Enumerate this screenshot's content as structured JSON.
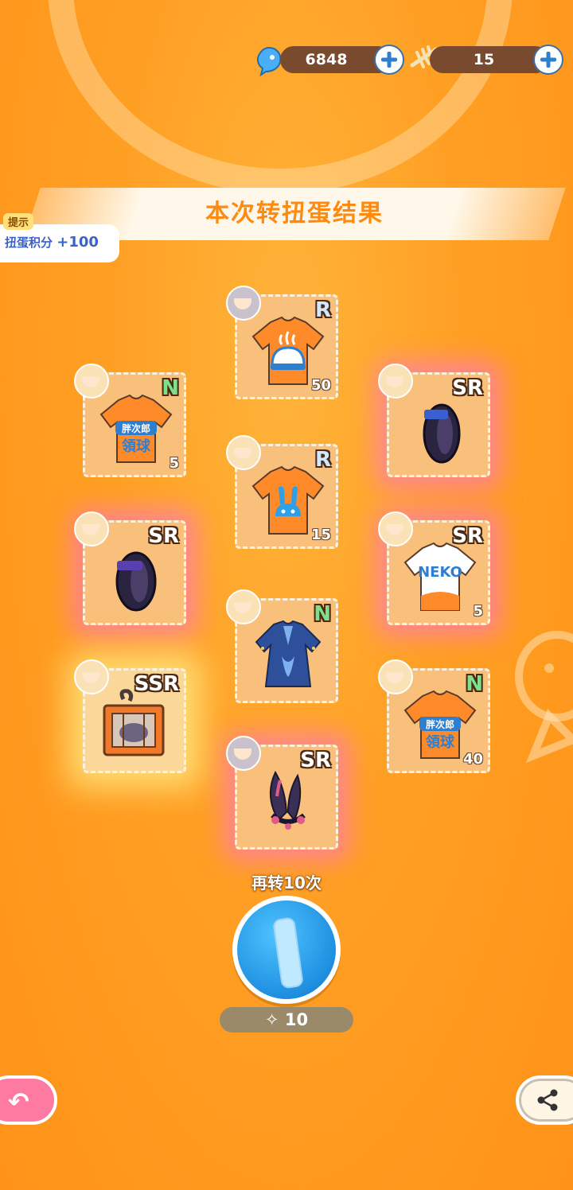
{
  "currency": {
    "gems": {
      "icon": "blue-fish-gem-icon",
      "value": "6848"
    },
    "tickets": {
      "icon": "fish-bone-ticket-icon",
      "value": "15"
    }
  },
  "banner": {
    "title": "本次转扭蛋结果"
  },
  "tip": {
    "tag": "提示",
    "label": "扭蛋积分",
    "points": "+100"
  },
  "items": [
    {
      "rarity": "N",
      "count": "5",
      "kind": "orange-shirt",
      "avatar": "cat-girl"
    },
    {
      "rarity": "R",
      "count": "50",
      "kind": "onsen-shirt",
      "avatar": "gray-girl"
    },
    {
      "rarity": "SR",
      "count": "",
      "kind": "black-ring",
      "avatar": "cat-girl"
    },
    {
      "rarity": "SR",
      "count": "",
      "kind": "black-ring",
      "avatar": "cat-girl"
    },
    {
      "rarity": "R",
      "count": "15",
      "kind": "bunny-shirt",
      "avatar": "cat-girl"
    },
    {
      "rarity": "SR",
      "count": "5",
      "kind": "neko-shirt",
      "avatar": "cat-girl"
    },
    {
      "rarity": "SSR",
      "count": "",
      "kind": "cat-crate",
      "avatar": "cat-girl"
    },
    {
      "rarity": "N",
      "count": "",
      "kind": "blue-dress",
      "avatar": "cat-girl"
    },
    {
      "rarity": "N",
      "count": "40",
      "kind": "orange-shirt",
      "avatar": "cat-girl"
    },
    {
      "rarity": "SR",
      "count": "",
      "kind": "bunny-ears",
      "avatar": "gray-girl"
    }
  ],
  "shirt_logo": {
    "line1": "胖次郎",
    "line2": "領球",
    "neko": "NEKO"
  },
  "spin": {
    "label": "再转10次",
    "cost": "10",
    "cost_icon": "fish-bone-ticket-icon"
  },
  "buttons": {
    "back_icon": "back-arrow-icon",
    "share_icon": "share-icon"
  },
  "colors": {
    "background": "#ff9f24",
    "title": "#ff8a10",
    "spin": "#1f8fe0"
  }
}
